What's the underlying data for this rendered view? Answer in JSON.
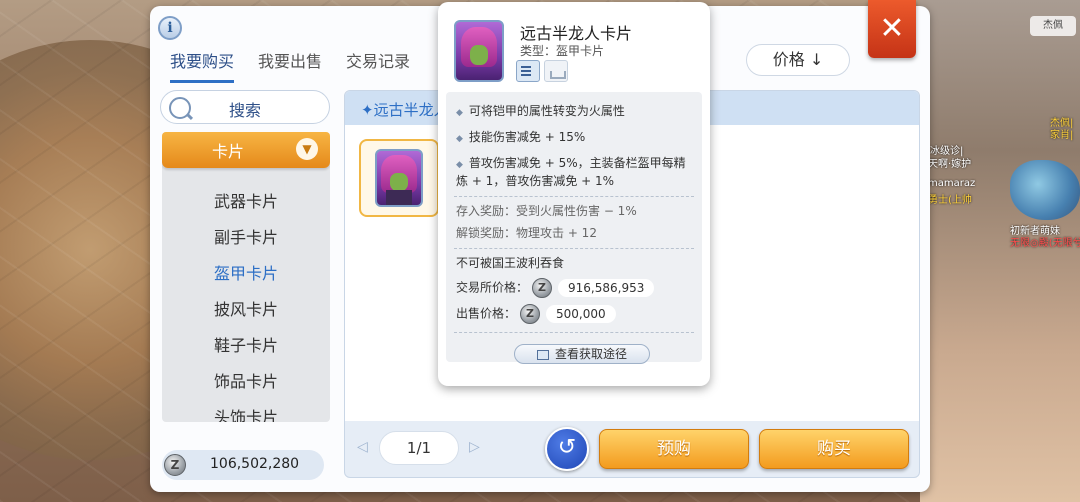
{
  "window": {
    "tabs": [
      {
        "label": "我要购买",
        "active": true
      },
      {
        "label": "我要出售",
        "active": false
      },
      {
        "label": "交易记录",
        "active": false
      }
    ],
    "sort_label": "价格 ↓",
    "search_label": "搜索"
  },
  "sidebar": {
    "category": "卡片",
    "items": [
      {
        "label": "武器卡片"
      },
      {
        "label": "副手卡片"
      },
      {
        "label": "盔甲卡片",
        "active": true
      },
      {
        "label": "披风卡片"
      },
      {
        "label": "鞋子卡片"
      },
      {
        "label": "饰品卡片"
      },
      {
        "label": "头饰卡片"
      }
    ]
  },
  "wallet": {
    "amount": "106,502,280",
    "coin_glyph": "Z"
  },
  "content": {
    "result_title": "✦远古半龙人",
    "pager": {
      "current": "1/1",
      "prev": "◁",
      "next": "▷"
    },
    "refresh_glyph": "↺",
    "preorder_label": "预购",
    "buy_label": "购买"
  },
  "tooltip": {
    "name": "远古半龙人卡片",
    "type": "类型：盔甲卡片",
    "effects": [
      "可将铠甲的属性转变为火属性",
      "技能伤害减免 + 15%",
      "普攻伤害减免 + 5%，主装备栏盔甲每精",
      "炼 + 1，普攻伤害减免 + 1%"
    ],
    "deposit_reward": "存入奖励：受到火属性伤害 − 1%",
    "unlock_reward": "解锁奖励：物理攻击 + 12",
    "restriction": "不可被国王波利吞食",
    "exchange_price_label": "交易所价格：",
    "exchange_price": "916,586,953",
    "sell_price_label": "出售价格：",
    "sell_price": "500,000",
    "route_button": "查看获取途径"
  },
  "scene": {
    "badge": "杰佩",
    "player_labels": [
      "杰佩|",
      "家肖|",
      "冰级诊|",
      "天啊·嫁护",
      "mamaraz",
      "勇士(上帅",
      "初新者萌妹",
      "无限◎殿(无限兮"
    ]
  },
  "colors": {
    "accent": "#2d6fc5",
    "orange": "#f39b1e",
    "close": "#d23d1d"
  }
}
